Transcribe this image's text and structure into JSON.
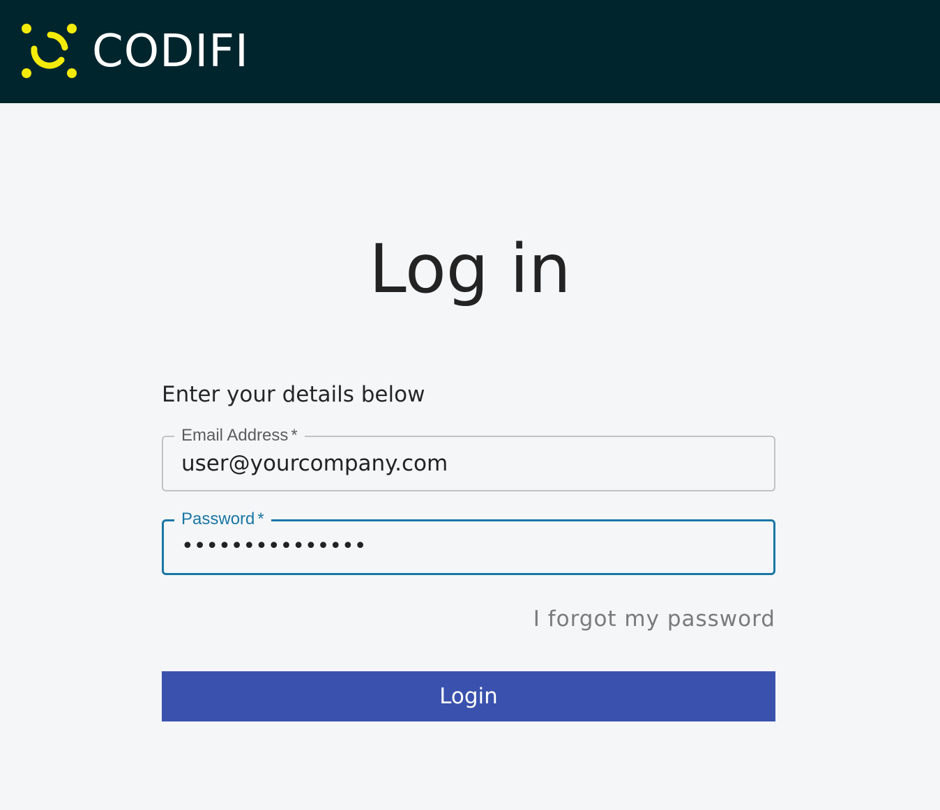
{
  "header": {
    "brand_name": "CODIFI",
    "logo_icon": "codifi-logo-icon",
    "background_color": "#00252d",
    "logo_color": "#f5eb0a"
  },
  "main": {
    "title": "Log in",
    "subtitle": "Enter your details below",
    "email": {
      "label": "Email Address",
      "required_marker": "*",
      "value": "user@yourcompany.com"
    },
    "password": {
      "label": "Password",
      "required_marker": "*",
      "value": "•••••••••••••••",
      "focus_color": "#1a77a4"
    },
    "forgot_link": "I forgot my password",
    "login_button": "Login",
    "button_color": "#3a52ad"
  }
}
